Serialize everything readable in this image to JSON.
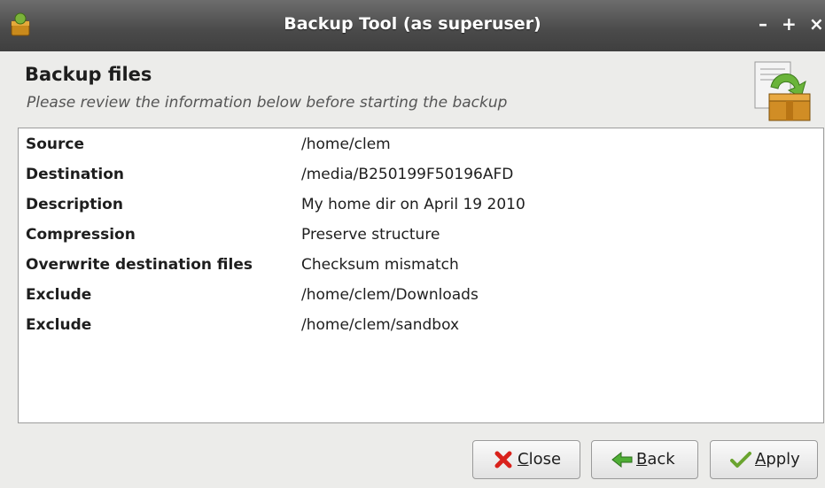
{
  "window": {
    "title": "Backup Tool (as superuser)",
    "controls": {
      "minimize": "–",
      "maximize": "+",
      "close": "×"
    }
  },
  "header": {
    "title": "Backup files",
    "subtitle": "Please review the information below before starting the backup",
    "icon": "backup-box-icon"
  },
  "details": [
    {
      "key": "Source",
      "value": "/home/clem"
    },
    {
      "key": "Destination",
      "value": "/media/B250199F50196AFD"
    },
    {
      "key": "Description",
      "value": "My home dir on April 19 2010"
    },
    {
      "key": "Compression",
      "value": "Preserve structure"
    },
    {
      "key": "Overwrite destination files",
      "value": "Checksum mismatch"
    },
    {
      "key": "Exclude",
      "value": "/home/clem/Downloads"
    },
    {
      "key": "Exclude",
      "value": "/home/clem/sandbox"
    }
  ],
  "buttons": {
    "close": {
      "label": "Close",
      "icon": "red-x-icon"
    },
    "back": {
      "label": "Back",
      "icon": "back-arrow-icon"
    },
    "apply": {
      "label": "Apply",
      "icon": "checkmark-icon"
    }
  },
  "colors": {
    "titlebar": "#4a4a4a",
    "panel_bg": "#ffffff",
    "window_bg": "#ececea",
    "close_icon": "#d9221c",
    "back_icon": "#3f9a2e",
    "apply_icon": "#6aa42f"
  }
}
